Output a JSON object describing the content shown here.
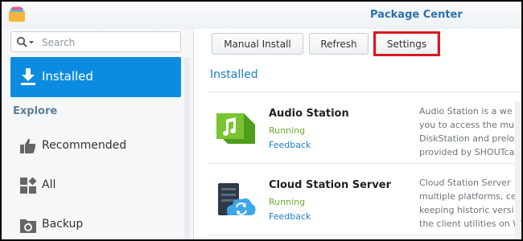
{
  "window": {
    "title": "Package Center",
    "icon": "package-center-icon"
  },
  "sidebar": {
    "search_placeholder": "Search",
    "installed": {
      "label": "Installed",
      "icon": "download-icon"
    },
    "section_label": "Explore",
    "items": [
      {
        "label": "Recommended",
        "icon": "thumbs-up-icon"
      },
      {
        "label": "All",
        "icon": "grid-icon"
      },
      {
        "label": "Backup",
        "icon": "backup-icon"
      }
    ]
  },
  "toolbar": {
    "manual_install": "Manual Install",
    "refresh": "Refresh",
    "settings": "Settings"
  },
  "main": {
    "heading": "Installed",
    "packages": [
      {
        "name": "Audio Station",
        "status": "Running",
        "feedback": "Feedback",
        "icon": "audio-station-icon",
        "description": [
          "Audio Station is a we",
          "you to access the mu",
          "DiskStation and prelo",
          "provided by SHOUTca"
        ]
      },
      {
        "name": "Cloud Station Server",
        "status": "Running",
        "feedback": "Feedback",
        "icon": "cloud-station-icon",
        "description": [
          "Cloud Station Server",
          "multiple platforms, ce",
          "keeping historic versi",
          "the client utilities on W"
        ]
      }
    ]
  },
  "colors": {
    "accent": "#0b8ce0",
    "running": "#65b32e",
    "link": "#1d7ec7",
    "highlight": "#d71a21"
  }
}
